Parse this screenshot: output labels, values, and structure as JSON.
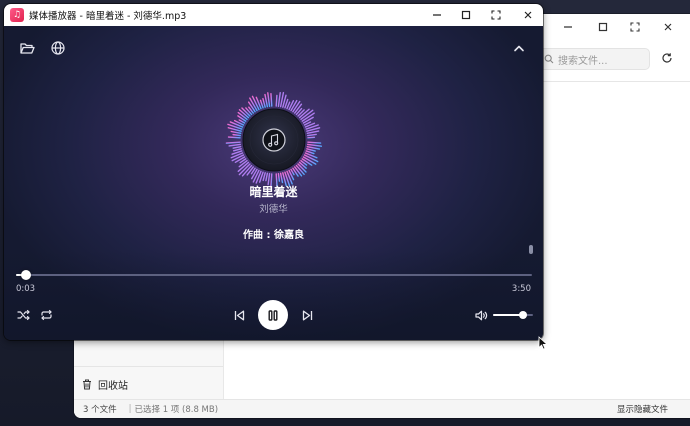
{
  "player": {
    "window_title": "媒体播放器 - 暗里着迷 - 刘德华.mp3",
    "song_title": "暗里着迷",
    "artist": "刘德华",
    "composer": "作曲 : 徐嘉良",
    "current_time": "0:03",
    "total_time": "3:50",
    "progress_fraction": 0.02,
    "volume_fraction": 0.75,
    "icons": {
      "app": "music-note-icon",
      "open_folder": "folder-open-icon",
      "network": "globe-icon",
      "collapse": "chevron-up-icon",
      "shuffle": "shuffle-icon",
      "repeat": "repeat-icon",
      "previous": "skip-previous-icon",
      "play_pause": "pause-icon",
      "next": "skip-next-icon",
      "volume": "volume-icon",
      "disc": "music-note-icon"
    },
    "colors": {
      "accent_white": "#ffffff",
      "ring_pink": "#f06cd0",
      "ring_blue": "#4fa9ff",
      "background": "#2a2650"
    }
  },
  "file_manager": {
    "search_placeholder": "搜索文件...",
    "sidebar": {
      "trash_label": "回收站"
    },
    "status": {
      "file_count": "3 个文件",
      "selected": "已选择 1 项 (8.8 MB)",
      "show_hidden": "显示隐藏文件"
    }
  }
}
